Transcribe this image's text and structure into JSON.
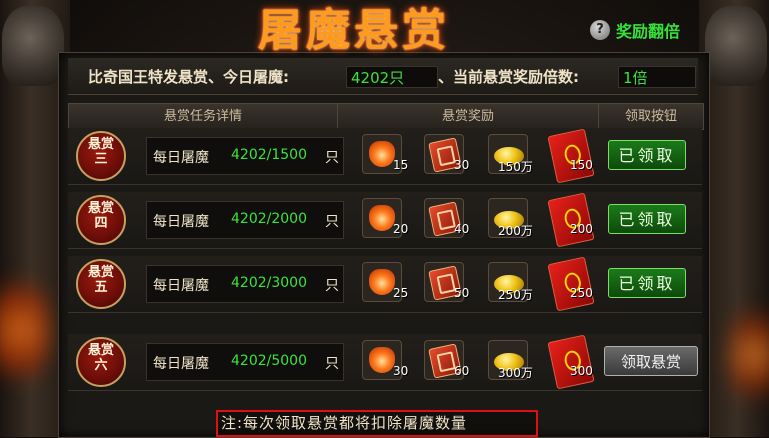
{
  "title": "屠魔悬赏",
  "double_reward": {
    "icon": "question-icon",
    "icon_glyph": "?",
    "label": "奖励翻倍"
  },
  "info": {
    "prefix": "比奇国王特发悬赏、今日屠魔:",
    "kills": "4202只",
    "middle": "、当前悬赏奖励倍数:",
    "multiplier": "1倍"
  },
  "columns": {
    "task": "悬赏任务详情",
    "reward": "悬赏奖励",
    "action": "领取按钮"
  },
  "rows": [
    {
      "seal_line1": "悬赏",
      "seal_line2": "三",
      "task": "每日屠魔",
      "progress": "4202/1500",
      "unit": "只",
      "rewards": [
        "15",
        "30",
        "150万",
        "150"
      ],
      "button": "已领取",
      "claimed": true
    },
    {
      "seal_line1": "悬赏",
      "seal_line2": "四",
      "task": "每日屠魔",
      "progress": "4202/2000",
      "unit": "只",
      "rewards": [
        "20",
        "40",
        "200万",
        "200"
      ],
      "button": "已领取",
      "claimed": true
    },
    {
      "seal_line1": "悬赏",
      "seal_line2": "五",
      "task": "每日屠魔",
      "progress": "4202/3000",
      "unit": "只",
      "rewards": [
        "25",
        "50",
        "250万",
        "250"
      ],
      "button": "已领取",
      "claimed": true
    },
    {
      "seal_line1": "悬赏",
      "seal_line2": "六",
      "task": "每日屠魔",
      "progress": "4202/5000",
      "unit": "只",
      "rewards": [
        "30",
        "60",
        "300万",
        "300"
      ],
      "button": "领取悬赏",
      "claimed": false
    }
  ],
  "reward_icons": [
    "gem-icon",
    "scroll-icon",
    "gold-ingot-icon",
    "red-packet-icon"
  ],
  "note": "注:每次领取悬赏都将扣除屠魔数量",
  "colors": {
    "accent_green": "#3ee23c",
    "title_orange": "#ff9a1c",
    "note_border": "#e01010"
  }
}
